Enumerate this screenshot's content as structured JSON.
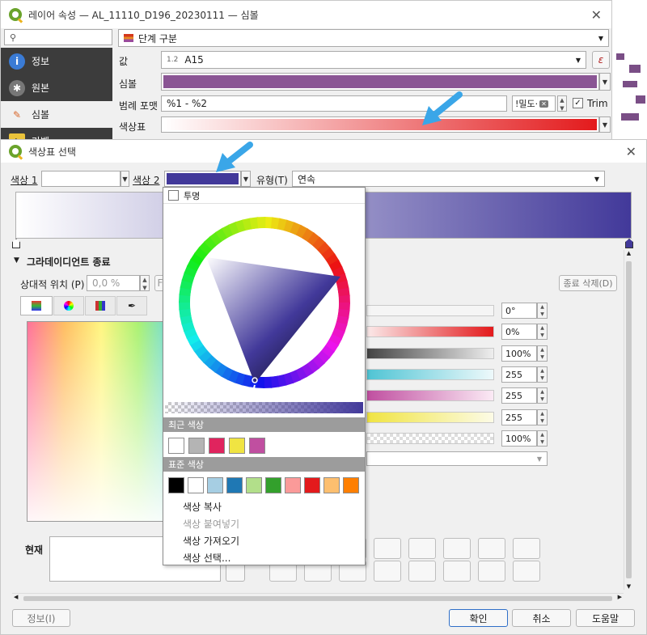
{
  "layer_dialog": {
    "title": "레이어 속성 — AL_11110_D196_20230111 — 심볼",
    "renderer": "단계 구분",
    "sidebar": [
      "정보",
      "원본",
      "심볼",
      "라벨"
    ],
    "value_label": "값",
    "value_prefix": "1.2",
    "value": "A15",
    "symbol_label": "심볼",
    "legend_format_label": "범례 포맷",
    "legend_format": "%1 - %2",
    "precision_label": "!밀도·",
    "trim_label": "Trim",
    "color_ramp_label": "색상표",
    "expr_symbol": "ε"
  },
  "ramp_dialog": {
    "title": "색상표 선택",
    "color1_label": "색상 1",
    "color2_label": "색상 2",
    "type_label": "유형(T)",
    "type_value": "연속",
    "gradient_stop_label": "그라데이디언트 종료",
    "relative_pos_label": "상대적 위치 (P)",
    "relative_pos_value": "0,0 %",
    "delete_stop_label": "종료 삭제(D)",
    "current_label": "현재",
    "info_button": "정보(I)",
    "ok_button": "확인",
    "cancel_button": "취소",
    "help_button": "도움말",
    "field_values": [
      "0°",
      "0%",
      "100%",
      "255",
      "255",
      "255",
      "100%"
    ]
  },
  "color_popup": {
    "transparent_label": "투명",
    "recent_header": "최근 색상",
    "standard_header": "표준 색상",
    "recent_colors": [
      "#ffffff",
      "#b4b4b4",
      "#e0245e",
      "#f0e442",
      "#c04fa0"
    ],
    "standard_colors": [
      "#000000",
      "#ffffff",
      "#a6cee3",
      "#1f78b4",
      "#b2df8a",
      "#33a02c",
      "#fb9a99",
      "#e31a1c",
      "#fdbf6f",
      "#ff7f00"
    ],
    "menu": [
      "색상 복사",
      "색상 붙여넣기",
      "색상 가져오기",
      "색상 선택..."
    ]
  },
  "colors": {
    "accent_purple": "#42399a",
    "symbol_purple": "#8a5594",
    "ramp_red": "#e31a1c"
  }
}
